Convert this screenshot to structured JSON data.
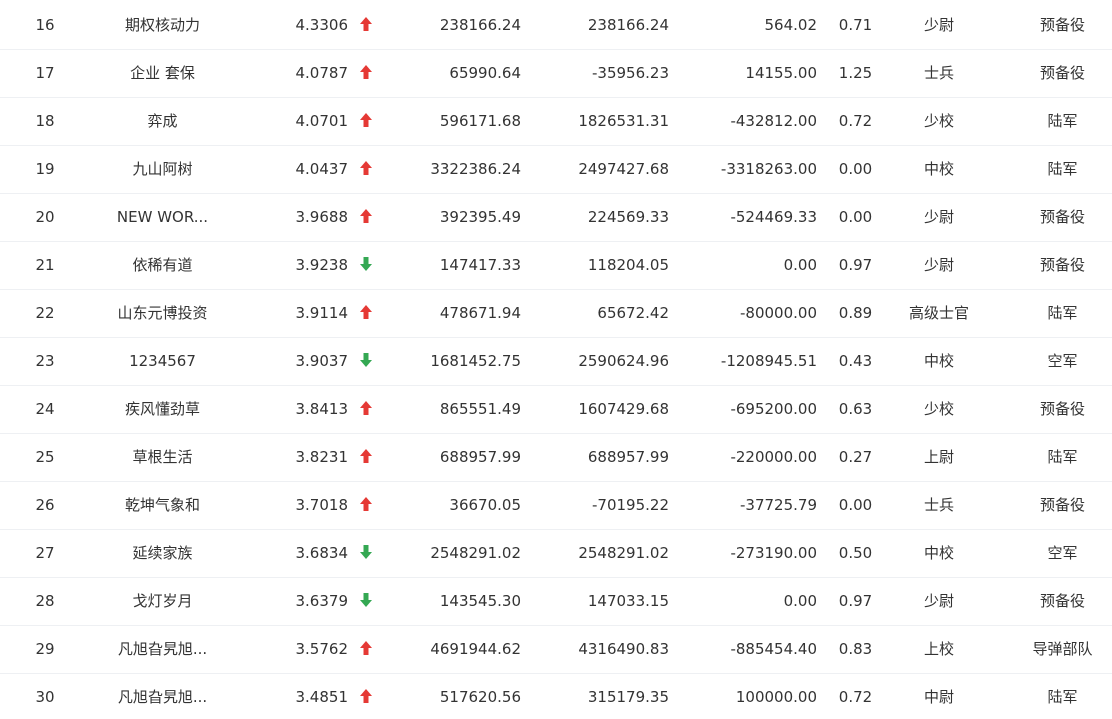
{
  "colors": {
    "up": "#e53935",
    "down": "#34a853"
  },
  "rows": [
    {
      "rank": "16",
      "name": "期权核动力",
      "score": "4.3306",
      "trend": "up",
      "v1": "238166.24",
      "v2": "238166.24",
      "v3": "564.02",
      "ratio": "0.71",
      "mil_rank": "少尉",
      "branch": "预备役"
    },
    {
      "rank": "17",
      "name": "企业 套保",
      "score": "4.0787",
      "trend": "up",
      "v1": "65990.64",
      "v2": "-35956.23",
      "v3": "14155.00",
      "ratio": "1.25",
      "mil_rank": "士兵",
      "branch": "预备役"
    },
    {
      "rank": "18",
      "name": "弈成",
      "score": "4.0701",
      "trend": "up",
      "v1": "596171.68",
      "v2": "1826531.31",
      "v3": "-432812.00",
      "ratio": "0.72",
      "mil_rank": "少校",
      "branch": "陆军"
    },
    {
      "rank": "19",
      "name": "九山阿树",
      "score": "4.0437",
      "trend": "up",
      "v1": "3322386.24",
      "v2": "2497427.68",
      "v3": "-3318263.00",
      "ratio": "0.00",
      "mil_rank": "中校",
      "branch": "陆军"
    },
    {
      "rank": "20",
      "name": "NEW WOR...",
      "score": "3.9688",
      "trend": "up",
      "v1": "392395.49",
      "v2": "224569.33",
      "v3": "-524469.33",
      "ratio": "0.00",
      "mil_rank": "少尉",
      "branch": "预备役"
    },
    {
      "rank": "21",
      "name": "依稀有道",
      "score": "3.9238",
      "trend": "down",
      "v1": "147417.33",
      "v2": "118204.05",
      "v3": "0.00",
      "ratio": "0.97",
      "mil_rank": "少尉",
      "branch": "预备役"
    },
    {
      "rank": "22",
      "name": "山东元博投资",
      "score": "3.9114",
      "trend": "up",
      "v1": "478671.94",
      "v2": "65672.42",
      "v3": "-80000.00",
      "ratio": "0.89",
      "mil_rank": "高级士官",
      "branch": "陆军"
    },
    {
      "rank": "23",
      "name": "1234567",
      "score": "3.9037",
      "trend": "down",
      "v1": "1681452.75",
      "v2": "2590624.96",
      "v3": "-1208945.51",
      "ratio": "0.43",
      "mil_rank": "中校",
      "branch": "空军"
    },
    {
      "rank": "24",
      "name": "疾风懂劲草",
      "score": "3.8413",
      "trend": "up",
      "v1": "865551.49",
      "v2": "1607429.68",
      "v3": "-695200.00",
      "ratio": "0.63",
      "mil_rank": "少校",
      "branch": "预备役"
    },
    {
      "rank": "25",
      "name": "草根生活",
      "score": "3.8231",
      "trend": "up",
      "v1": "688957.99",
      "v2": "688957.99",
      "v3": "-220000.00",
      "ratio": "0.27",
      "mil_rank": "上尉",
      "branch": "陆军"
    },
    {
      "rank": "26",
      "name": "乾坤气象和",
      "score": "3.7018",
      "trend": "up",
      "v1": "36670.05",
      "v2": "-70195.22",
      "v3": "-37725.79",
      "ratio": "0.00",
      "mil_rank": "士兵",
      "branch": "预备役"
    },
    {
      "rank": "27",
      "name": "延续家族",
      "score": "3.6834",
      "trend": "down",
      "v1": "2548291.02",
      "v2": "2548291.02",
      "v3": "-273190.00",
      "ratio": "0.50",
      "mil_rank": "中校",
      "branch": "空军"
    },
    {
      "rank": "28",
      "name": "戈灯岁月",
      "score": "3.6379",
      "trend": "down",
      "v1": "143545.30",
      "v2": "147033.15",
      "v3": "0.00",
      "ratio": "0.97",
      "mil_rank": "少尉",
      "branch": "预备役"
    },
    {
      "rank": "29",
      "name": "凡旭旮旯旭...",
      "score": "3.5762",
      "trend": "up",
      "v1": "4691944.62",
      "v2": "4316490.83",
      "v3": "-885454.40",
      "ratio": "0.83",
      "mil_rank": "上校",
      "branch": "导弹部队"
    },
    {
      "rank": "30",
      "name": "凡旭旮旯旭...",
      "score": "3.4851",
      "trend": "up",
      "v1": "517620.56",
      "v2": "315179.35",
      "v3": "100000.00",
      "ratio": "0.72",
      "mil_rank": "中尉",
      "branch": "陆军"
    }
  ]
}
